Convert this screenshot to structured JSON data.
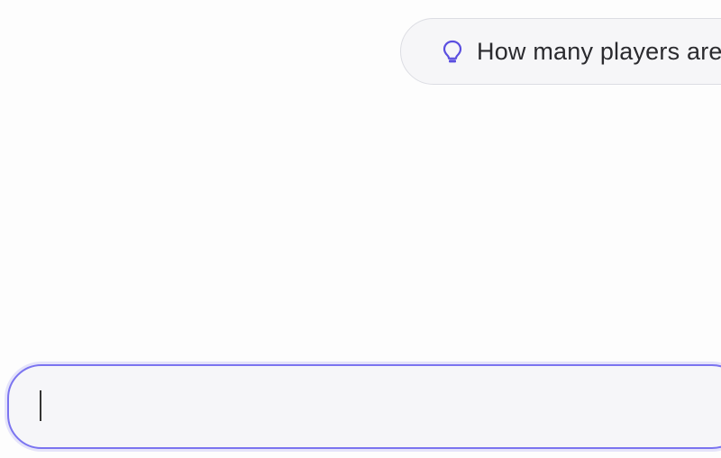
{
  "suggestion": {
    "icon": "lightbulb-icon",
    "text": "How many players are",
    "icon_color": "#5b4fe0"
  },
  "chat_input": {
    "value": "",
    "placeholder": "",
    "focus_color": "#7b74f0"
  }
}
